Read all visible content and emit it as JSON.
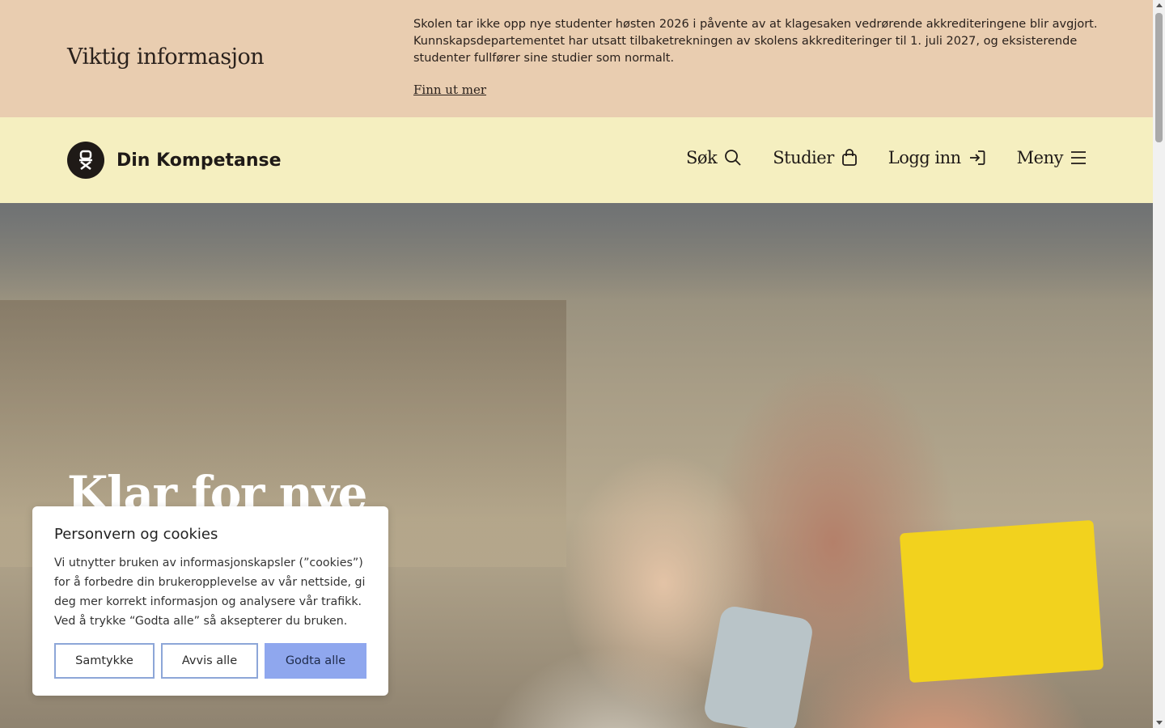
{
  "notice": {
    "title": "Viktig informasjon",
    "text": "Skolen tar ikke opp nye studenter høsten 2026 i påvente av at klagesaken vedrørende akkrediteringene blir avgjort. Kunnskapsdepartementet har utsatt tilbaketrekningen av skolens akkrediteringer til 1. juli 2027, og eksisterende studenter fullfører sine studier som normalt.",
    "link_label": "Finn ut mer"
  },
  "header": {
    "brand": "Din Kompetanse",
    "nav": [
      {
        "label": "Søk",
        "icon": "search-icon"
      },
      {
        "label": "Studier",
        "icon": "bag-icon"
      },
      {
        "label": "Logg inn",
        "icon": "login-icon"
      },
      {
        "label": "Meny",
        "icon": "hamburger-icon"
      }
    ]
  },
  "hero": {
    "title": "Klar for nye"
  },
  "cookie": {
    "title": "Personvern og cookies",
    "text": "Vi utnytter bruken av informasjonskapsler (”cookies”) for å forbedre din brukeropplevelse av vår nettside, gi deg mer korrekt informasjon og analysere vår trafikk. Ved å trykke “Godta alle” så aksepterer du bruken.",
    "buttons": {
      "consent": "Samtykke",
      "reject": "Avvis alle",
      "accept": "Godta alle"
    }
  },
  "colors": {
    "notice_bg": "#e9cdb0",
    "header_bg": "#f5efc0",
    "accept_button": "#8fa7ee",
    "button_border": "#8da6d8"
  }
}
